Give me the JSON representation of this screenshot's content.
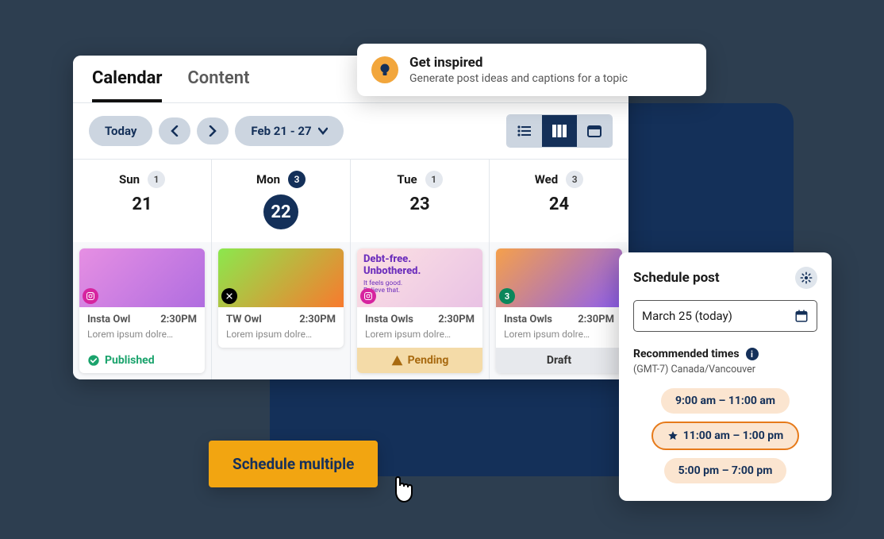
{
  "tabs": {
    "calendar": "Calendar",
    "content": "Content"
  },
  "toolbar": {
    "today": "Today",
    "range": "Feb 21 - 27"
  },
  "inspire": {
    "title": "Get inspired",
    "sub": "Generate post ideas and captions for a topic"
  },
  "days": [
    {
      "label": "Sun",
      "num": "21",
      "count": "1"
    },
    {
      "label": "Mon",
      "num": "22",
      "count": "3"
    },
    {
      "label": "Tue",
      "num": "23",
      "count": "1"
    },
    {
      "label": "Wed",
      "num": "24",
      "count": "3"
    }
  ],
  "cards": [
    {
      "title": "Insta Owl",
      "time": "2:30PM",
      "text": "Lorem ipsum dolre…",
      "status": "Published"
    },
    {
      "title": "TW Owl",
      "time": "2:30PM",
      "text": "Lorem ipsum dolre…"
    },
    {
      "title": "Insta Owls",
      "time": "2:30PM",
      "text": "Lorem ipsum dolre…",
      "status": "Pending",
      "overlay_title": "Debt-free.\nUnbothered.",
      "overlay_sub": "It feels good.\nBelieve that."
    },
    {
      "title": "Insta Owls",
      "time": "2:30PM",
      "text": "Lorem ipsum dolre…",
      "status": "Draft",
      "chip": "3"
    }
  ],
  "schedule": {
    "title": "Schedule post",
    "date": "March 25 (today)",
    "rec_label": "Recommended times",
    "tz": "(GMT-7) Canada/Vancouver",
    "times": [
      "9:00 am – 11:00 am",
      "11:00 am – 1:00 pm",
      "5:00 pm – 7:00 pm"
    ]
  },
  "cta": {
    "schedule_multiple": "Schedule multiple"
  }
}
